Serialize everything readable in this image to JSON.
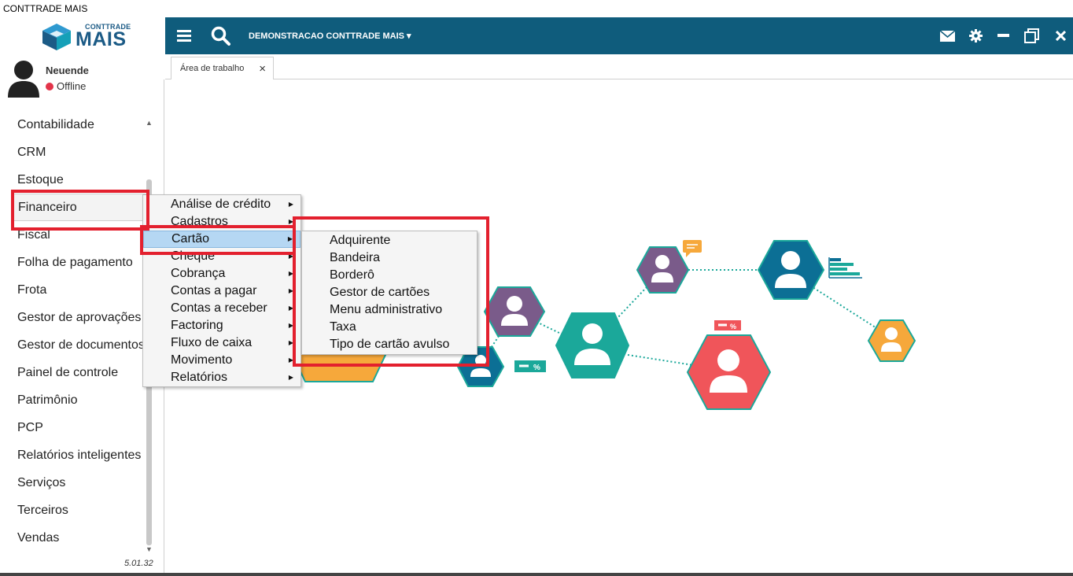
{
  "window": {
    "title": "CONTTRADE MAIS"
  },
  "logo": {
    "small": "CONTTRADE",
    "big": "MAIS"
  },
  "user": {
    "name": "Neuende",
    "status": "Offline"
  },
  "sidebar": {
    "items": [
      {
        "label": "Contabilidade"
      },
      {
        "label": "CRM"
      },
      {
        "label": "Estoque"
      },
      {
        "label": "Financeiro"
      },
      {
        "label": "Fiscal"
      },
      {
        "label": "Folha de pagamento"
      },
      {
        "label": "Frota"
      },
      {
        "label": "Gestor de aprovações"
      },
      {
        "label": "Gestor de documentos"
      },
      {
        "label": "Painel de controle"
      },
      {
        "label": "Patrimônio"
      },
      {
        "label": "PCP"
      },
      {
        "label": "Relatórios inteligentes"
      },
      {
        "label": "Serviços"
      },
      {
        "label": "Terceiros"
      },
      {
        "label": "Vendas"
      }
    ],
    "selected": "Financeiro",
    "version": "5.01.32"
  },
  "header": {
    "company": "DEMONSTRACAO CONTTRADE MAIS"
  },
  "tabs": [
    {
      "label": "Área de trabalho",
      "close": "×"
    }
  ],
  "financeiro_menu": {
    "items": [
      {
        "label": "Análise de crédito"
      },
      {
        "label": "Cadastros"
      },
      {
        "label": "Cartão"
      },
      {
        "label": "Cheque"
      },
      {
        "label": "Cobrança"
      },
      {
        "label": "Contas a pagar"
      },
      {
        "label": "Contas a receber"
      },
      {
        "label": "Factoring"
      },
      {
        "label": "Fluxo de caixa"
      },
      {
        "label": "Movimento"
      },
      {
        "label": "Relatórios"
      }
    ],
    "highlighted": "Cartão"
  },
  "cartao_submenu": {
    "items": [
      {
        "label": "Adquirente"
      },
      {
        "label": "Bandeira"
      },
      {
        "label": "Borderô"
      },
      {
        "label": "Gestor de cartões"
      },
      {
        "label": "Menu administrativo"
      },
      {
        "label": "Taxa"
      },
      {
        "label": "Tipo de cartão avulso"
      }
    ]
  },
  "colors": {
    "topbar": "#0f5c7c",
    "highlight": "#b5d7f3",
    "annotation": "#e3202e",
    "hex_teal": "#1ba89a",
    "hex_purple": "#7a5b8a",
    "hex_blue": "#0c6f95",
    "hex_orange": "#f6a83b",
    "hex_red": "#f0555a"
  }
}
